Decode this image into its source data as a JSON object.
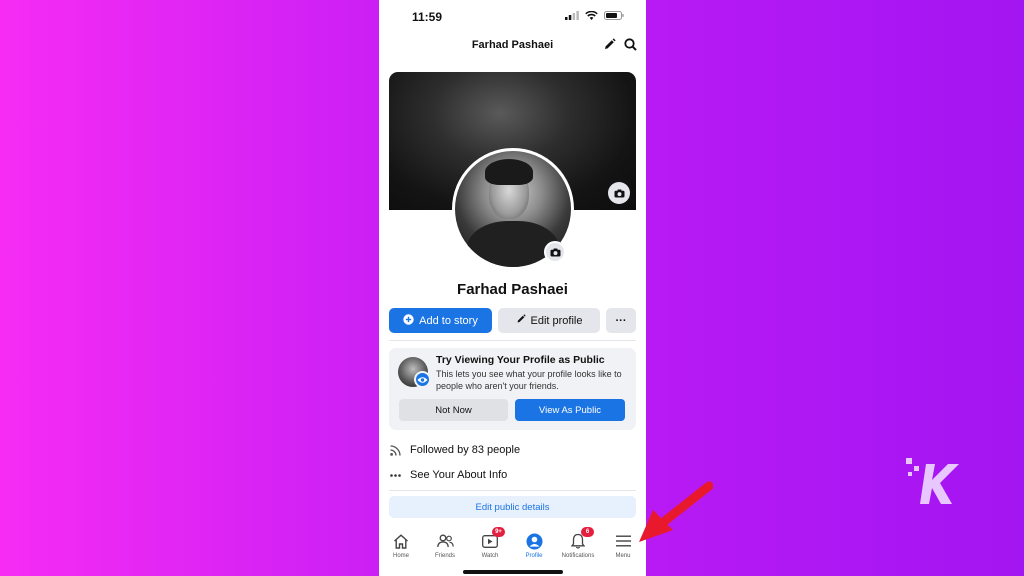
{
  "status_bar": {
    "time": "11:59"
  },
  "header": {
    "title": "Farhad Pashaei"
  },
  "profile": {
    "name": "Farhad Pashaei",
    "add_story_label": "Add to story",
    "edit_profile_label": "Edit profile",
    "more_label": "···"
  },
  "public_card": {
    "title": "Try Viewing Your Profile as Public",
    "description": "This lets you see what your profile looks like to people who aren't your friends.",
    "not_now_label": "Not Now",
    "view_public_label": "View As Public"
  },
  "info": {
    "followed_by": "Followed by 83 people",
    "about_info": "See Your About Info"
  },
  "edit_public_details_label": "Edit public details",
  "tabs": [
    {
      "label": "Home",
      "icon": "home-icon"
    },
    {
      "label": "Friends",
      "icon": "friends-icon"
    },
    {
      "label": "Watch",
      "icon": "watch-icon",
      "badge": "9+"
    },
    {
      "label": "Profile",
      "icon": "profile-icon",
      "active": true
    },
    {
      "label": "Notifications",
      "icon": "bell-icon",
      "badge": "6"
    },
    {
      "label": "Menu",
      "icon": "menu-icon"
    }
  ],
  "colors": {
    "accent": "#1b74e4",
    "badge": "#e41e3f",
    "arrow": "#e8192c"
  }
}
